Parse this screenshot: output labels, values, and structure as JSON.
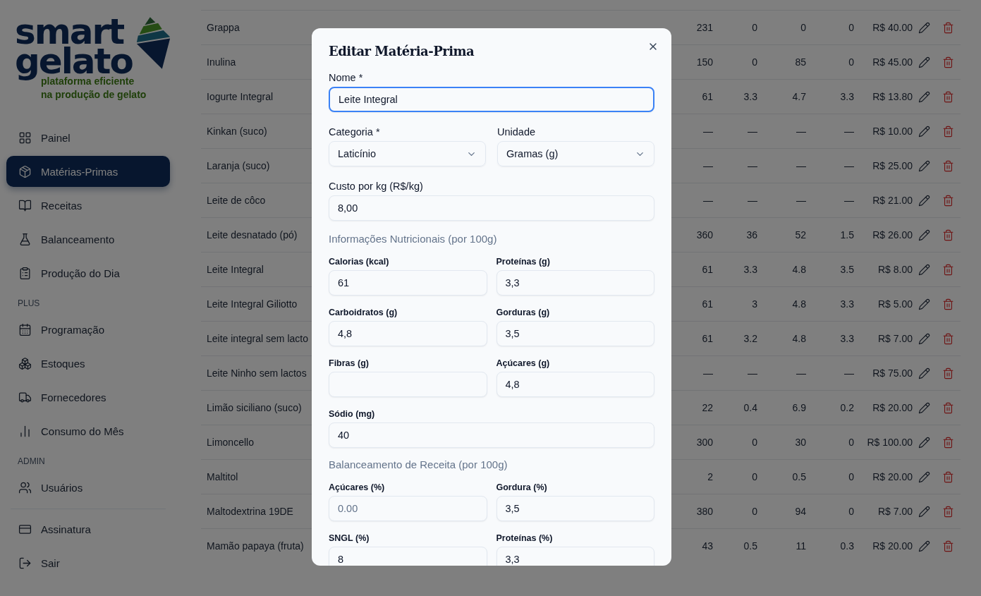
{
  "logo": {
    "wordmark": [
      "smart",
      "gelato"
    ],
    "tagline": [
      "plataforma eficiente",
      "na produção de gelato"
    ]
  },
  "sidebar": {
    "sections": [
      {
        "items": [
          {
            "label": "Painel",
            "selected": false
          },
          {
            "label": "Matérias-Primas",
            "selected": true
          },
          {
            "label": "Receitas",
            "selected": false
          },
          {
            "label": "Balanceamento",
            "selected": false
          },
          {
            "label": "Produção do Dia",
            "selected": false
          }
        ]
      },
      {
        "heading": "PLUS",
        "items": [
          {
            "label": "Programação",
            "selected": false
          },
          {
            "label": "Estoques",
            "selected": false
          },
          {
            "label": "Fornecedores",
            "selected": false
          },
          {
            "label": "Consumo do Mês",
            "selected": false
          }
        ]
      },
      {
        "heading": "ADMIN",
        "items": [
          {
            "label": "Usuários",
            "selected": false
          }
        ]
      },
      {
        "divider": true,
        "items": [
          {
            "label": "Assinatura",
            "selected": false
          },
          {
            "label": "Sair",
            "selected": false
          }
        ]
      }
    ]
  },
  "table": {
    "rows": [
      {
        "name": "Grappa",
        "cells": [
          "231",
          "0",
          "0",
          "0"
        ],
        "price": "R$ 40.00"
      },
      {
        "name": "Inulina",
        "cells": [
          "150",
          "0",
          "85",
          "0"
        ],
        "price": "R$ 45.00"
      },
      {
        "name": "Iogurte Integral",
        "cells": [
          "61",
          "3.3",
          "4.7",
          "3.3"
        ],
        "price": "R$ 13.80"
      },
      {
        "name": "Kinkan (suco)",
        "cells": [
          "—",
          "—",
          "—",
          "—"
        ],
        "price": "R$ 10.00"
      },
      {
        "name": "Laranja (suco)",
        "cells": [
          "—",
          "—",
          "—",
          "—"
        ],
        "price": "R$ 25.00"
      },
      {
        "name": "Leite de côco",
        "cells": [
          "—",
          "—",
          "—",
          "—"
        ],
        "price": "R$ 21.00"
      },
      {
        "name": "Leite desnatado (pó)",
        "cells": [
          "360",
          "36",
          "52",
          "1.5"
        ],
        "price": "R$ 26.00"
      },
      {
        "name": "Leite Integral",
        "cells": [
          "61",
          "3.3",
          "4.8",
          "3.5"
        ],
        "price": "R$ 8.00"
      },
      {
        "name": "Leite Integral Giliotto",
        "cells": [
          "61",
          "3",
          "4.8",
          "3.3"
        ],
        "price": "R$ 5.00"
      },
      {
        "name": "Leite integral sem lacto",
        "cells": [
          "61",
          "3.2",
          "4.8",
          "3.3"
        ],
        "price": "R$ 7.00"
      },
      {
        "name": "Leite Ninho sem lactos",
        "cells": [
          "—",
          "—",
          "—",
          "—"
        ],
        "price": "R$ 75.00"
      },
      {
        "name": "Limão siciliano (suco)",
        "cells": [
          "22",
          "0.4",
          "6.9",
          "0.2"
        ],
        "price": "R$ 20.00"
      },
      {
        "name": "Limoncello",
        "cells": [
          "300",
          "0",
          "30",
          "0"
        ],
        "price": "R$ 100.00"
      },
      {
        "name": "Maltitol",
        "cells": [
          "2",
          "0",
          "0.5",
          "0"
        ],
        "price": "R$ 20.00"
      },
      {
        "name": "Maltodextrina 19DE",
        "cells": [
          "380",
          "0",
          "94",
          "0"
        ],
        "price": "R$ 7.00"
      },
      {
        "name": "Mamão papaya (fruta)",
        "cells": [
          "43",
          "0.5",
          "11",
          "0.3"
        ],
        "price": "R$ 20.00"
      }
    ]
  },
  "modal": {
    "title": "Editar Matéria-Prima",
    "name_field": {
      "label": "Nome *",
      "value": "Leite Integral",
      "focused": true
    },
    "selects": [
      {
        "label": "Categoria *",
        "value": "Laticínio"
      },
      {
        "label": "Unidade",
        "value": "Gramas (g)"
      }
    ],
    "cost_field": {
      "label": "Custo por kg (R$/kg)",
      "value": "8,00"
    },
    "sections": [
      {
        "heading": "Informações Nutricionais (por 100g)",
        "fields": [
          {
            "label": "Calorias (kcal)",
            "value": "61"
          },
          {
            "label": "Proteínas (g)",
            "value": "3,3"
          },
          {
            "label": "Carboidratos (g)",
            "value": "4,8"
          },
          {
            "label": "Gorduras (g)",
            "value": "3,5"
          },
          {
            "label": "Fibras (g)"
          },
          {
            "label": "Açúcares (g)",
            "value": "4,8"
          },
          {
            "label": "Sódio (mg)",
            "value": "40",
            "wide": true
          }
        ]
      },
      {
        "heading": "Balanceamento de Receita (por 100g)",
        "fields": [
          {
            "label": "Açúcares (%)",
            "placeholder": "0.00"
          },
          {
            "label": "Gordura (%)",
            "value": "3,5"
          },
          {
            "label": "SNGL (%)",
            "value": "8"
          },
          {
            "label": "Proteínas (%)",
            "value": "3,3"
          }
        ]
      }
    ]
  }
}
